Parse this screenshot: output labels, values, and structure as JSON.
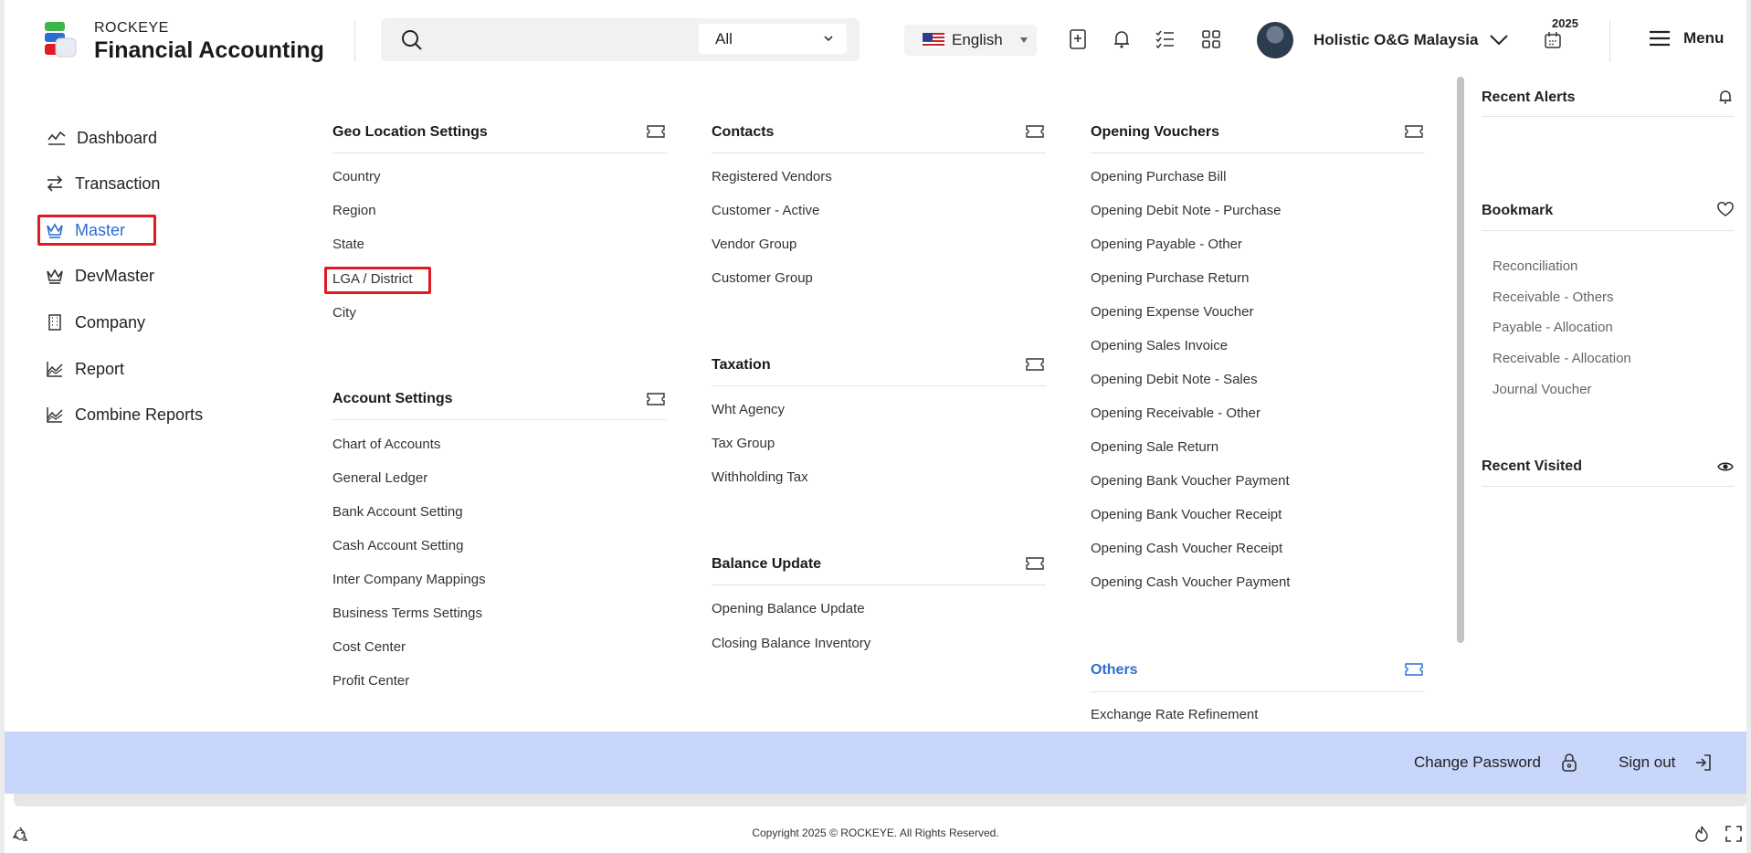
{
  "brand": {
    "top": "ROCKEYE",
    "main": "Financial Accounting"
  },
  "search": {
    "filter_value": "All"
  },
  "language": "English",
  "company": "Holistic O&G Malaysia",
  "year": "2025",
  "menu_label": "Menu",
  "sidebar": {
    "items": [
      {
        "label": "Dashboard",
        "icon": "chart-line-icon"
      },
      {
        "label": "Transaction",
        "icon": "arrows-exchange-icon"
      },
      {
        "label": "Master",
        "icon": "crown-icon",
        "active": true
      },
      {
        "label": "DevMaster",
        "icon": "crown-icon"
      },
      {
        "label": "Company",
        "icon": "building-icon"
      },
      {
        "label": "Report",
        "icon": "chart-area-icon"
      },
      {
        "label": "Combine Reports",
        "icon": "chart-area-icon"
      }
    ]
  },
  "sections": {
    "geo": {
      "title": "Geo Location Settings",
      "items": [
        "Country",
        "Region",
        "State",
        "LGA / District",
        "City"
      ]
    },
    "account": {
      "title": "Account Settings",
      "items": [
        "Chart of Accounts",
        "General Ledger",
        "Bank Account Setting",
        "Cash Account Setting",
        "Inter Company Mappings",
        "Business Terms Settings",
        "Cost Center",
        "Profit Center"
      ]
    },
    "contacts": {
      "title": "Contacts",
      "items": [
        "Registered Vendors",
        "Customer - Active",
        "Vendor Group",
        "Customer Group"
      ]
    },
    "taxation": {
      "title": "Taxation",
      "items": [
        "Wht Agency",
        "Tax Group",
        "Withholding Tax"
      ]
    },
    "balance": {
      "title": "Balance Update",
      "items": [
        "Opening Balance Update",
        "Closing Balance Inventory"
      ]
    },
    "opening": {
      "title": "Opening Vouchers",
      "items": [
        "Opening Purchase Bill",
        "Opening Debit Note - Purchase",
        "Opening Payable - Other",
        "Opening Purchase Return",
        "Opening Expense Voucher",
        "Opening Sales Invoice",
        "Opening Debit Note - Sales",
        "Opening Receivable - Other",
        "Opening Sale Return",
        "Opening Bank Voucher Payment",
        "Opening Bank Voucher Receipt",
        "Opening Cash Voucher Receipt",
        "Opening Cash Voucher Payment"
      ]
    },
    "others": {
      "title": "Others",
      "items": [
        "Exchange Rate Refinement"
      ]
    }
  },
  "right_panel": {
    "alerts_title": "Recent Alerts",
    "bookmark_title": "Bookmark",
    "bookmarks": [
      "Reconciliation",
      "Receivable - Others",
      "Payable - Allocation",
      "Receivable - Allocation",
      "Journal Voucher"
    ],
    "visited_title": "Recent Visited"
  },
  "footer": {
    "change_password": "Change Password",
    "sign_out": "Sign out",
    "copyright": "Copyright 2025 © ROCKEYE. All Rights Reserved."
  },
  "colors": {
    "accent": "#2b6ed1",
    "highlight": "#e11a22",
    "band": "#c8d6fb"
  }
}
